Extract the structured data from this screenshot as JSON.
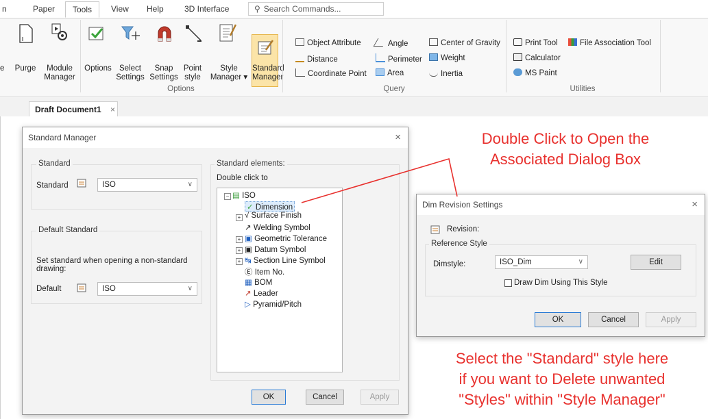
{
  "ribbon": {
    "tabs": [
      "n",
      "Paper",
      "Tools",
      "View",
      "Help",
      "3D Interface"
    ],
    "active_tab": "Tools",
    "search_placeholder": "Search Commands...",
    "buttons": {
      "edge_e": "e",
      "purge": "Purge",
      "module_manager_1": "Module",
      "module_manager_2": "Manager",
      "options": "Options",
      "select_settings_1": "Select",
      "select_settings_2": "Settings",
      "snap_settings_1": "Snap",
      "snap_settings_2": "Settings",
      "point_style_1": "Point",
      "point_style_2": "style",
      "style_manager_1": "Style",
      "style_manager_2": "Manager ▾",
      "standard_manager_1": "Standard",
      "standard_manager_2": "Manager"
    },
    "query": {
      "object_attribute": "Object Attribute",
      "distance": "Distance",
      "coordinate_point": "Coordinate Point",
      "angle": "Angle",
      "perimeter": "Perimeter",
      "area": "Area",
      "center_of_gravity": "Center of Gravity",
      "weight": "Weight",
      "inertia": "Inertia"
    },
    "utilities": {
      "print_tool": "Print Tool",
      "file_association_tool": "File Association Tool",
      "calculator": "Calculator",
      "ms_paint": "MS Paint"
    },
    "group_labels": {
      "options": "Options",
      "query": "Query",
      "utilities": "Utilities"
    }
  },
  "document_tab": {
    "label": "Draft Document1",
    "close": "×"
  },
  "standard_manager": {
    "title": "Standard Manager",
    "close": "×",
    "standard_group": "Standard",
    "standard_label": "Standard",
    "standard_value": "ISO",
    "default_group": "Default Standard",
    "default_desc_1": "Set standard when opening a non-standard",
    "default_desc_2": "drawing:",
    "default_label": "Default",
    "default_value": "ISO",
    "elements_group": "Standard elements:",
    "double_click_hint": "Double click to",
    "tree": {
      "root": "ISO",
      "items": [
        "Dimension",
        "Surface Finish",
        "Welding Symbol",
        "Geometric Tolerance",
        "Datum Symbol",
        "Section Line Symbol",
        "Item No.",
        "BOM",
        "Leader",
        "Pyramid/Pitch"
      ]
    },
    "ok": "OK",
    "cancel": "Cancel",
    "apply": "Apply"
  },
  "dim_revision": {
    "title": "Dim Revision Settings",
    "close": "×",
    "revision_label": "Revision:",
    "reference_group": "Reference Style",
    "dimstyle_label": "Dimstyle:",
    "dimstyle_value": "ISO_Dim",
    "edit": "Edit",
    "draw_checkbox": "Draw Dim Using This Style",
    "ok": "OK",
    "cancel": "Cancel",
    "apply": "Apply"
  },
  "annotations": {
    "top_1": "Double Click to Open the",
    "top_2": "Associated Dialog Box",
    "bottom_1": "Select the \"Standard\" style here",
    "bottom_2": "if you want to Delete unwanted",
    "bottom_3": "\"Styles\" within \"Style Manager\""
  },
  "colors": {
    "annotation": "#e8312e",
    "highlight": "#fbe4a8",
    "accent": "#2a7bd4"
  }
}
